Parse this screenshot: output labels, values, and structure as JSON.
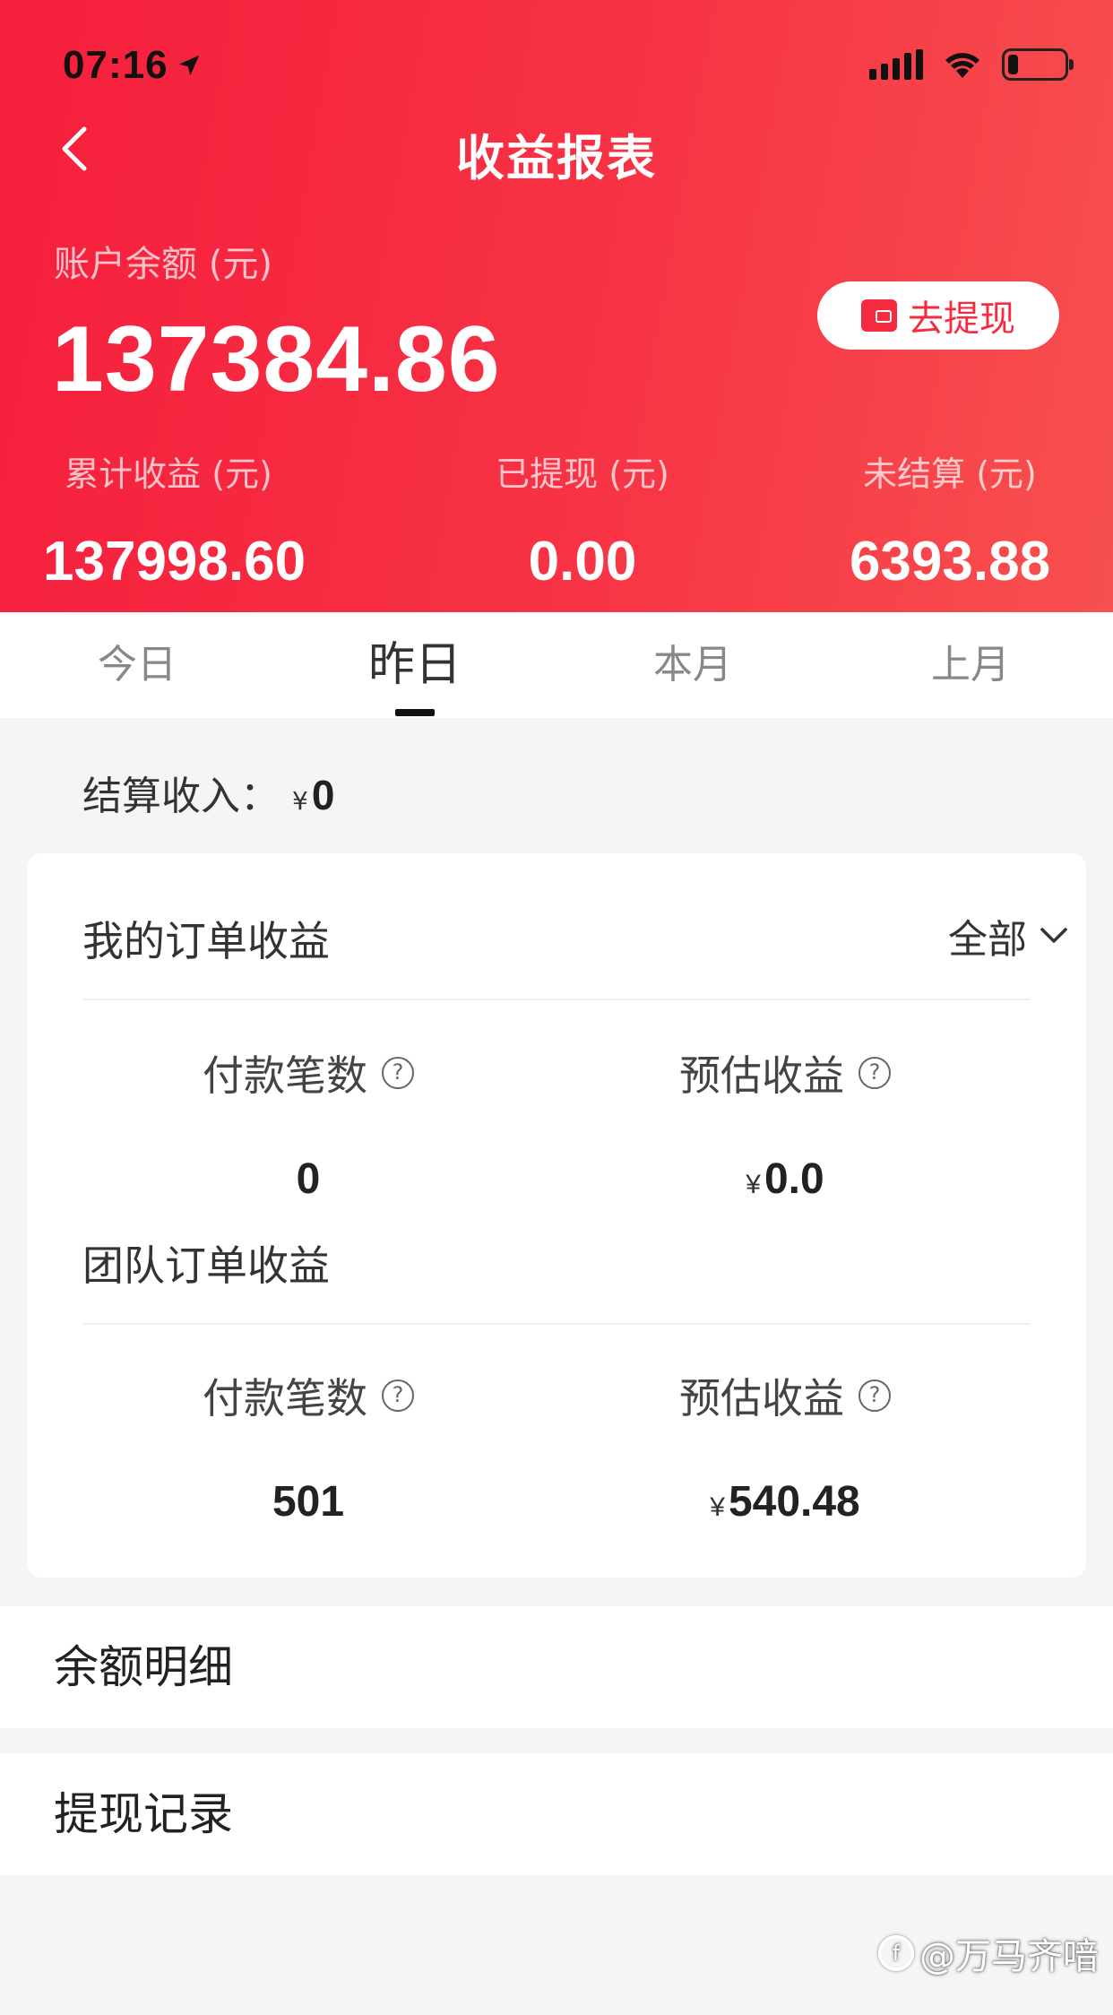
{
  "status_bar": {
    "time": "07:16"
  },
  "header": {
    "title": "收益报表",
    "balance_label": "账户余额 (元)",
    "balance_value": "137384.86",
    "withdraw_label": "去提现",
    "stats": [
      {
        "label": "累计收益 (元)",
        "value": "137998.60"
      },
      {
        "label": "已提现 (元)",
        "value": "0.00"
      },
      {
        "label": "未结算 (元)",
        "value": "6393.88"
      }
    ]
  },
  "tabs": [
    "今日",
    "昨日",
    "本月",
    "上月"
  ],
  "active_tab": "昨日",
  "settlement": {
    "label": "结算收入：",
    "currency": "¥",
    "amount": "0"
  },
  "my_orders": {
    "title": "我的订单收益",
    "filter": "全部",
    "count_label": "付款笔数",
    "count_value": "0",
    "income_label": "预估收益",
    "income_currency": "¥",
    "income_value": "0.0"
  },
  "team_orders": {
    "title": "团队订单收益",
    "count_label": "付款笔数",
    "count_value": "501",
    "income_label": "预估收益",
    "income_currency": "¥",
    "income_value": "540.48"
  },
  "links": {
    "balance_detail": "余额明细",
    "withdraw_records": "提现记录"
  },
  "watermark": "@万马齐喑",
  "icons": {
    "back": "chevron-left-icon",
    "location": "location-arrow-icon",
    "signal": "signal-icon",
    "wifi": "wifi-icon",
    "battery": "battery-icon",
    "wallet": "wallet-icon",
    "help": "question-circle-icon",
    "dropdown": "chevron-down-icon"
  },
  "colors": {
    "brand_red": "#f52b40",
    "background": "#f5f5f5"
  }
}
